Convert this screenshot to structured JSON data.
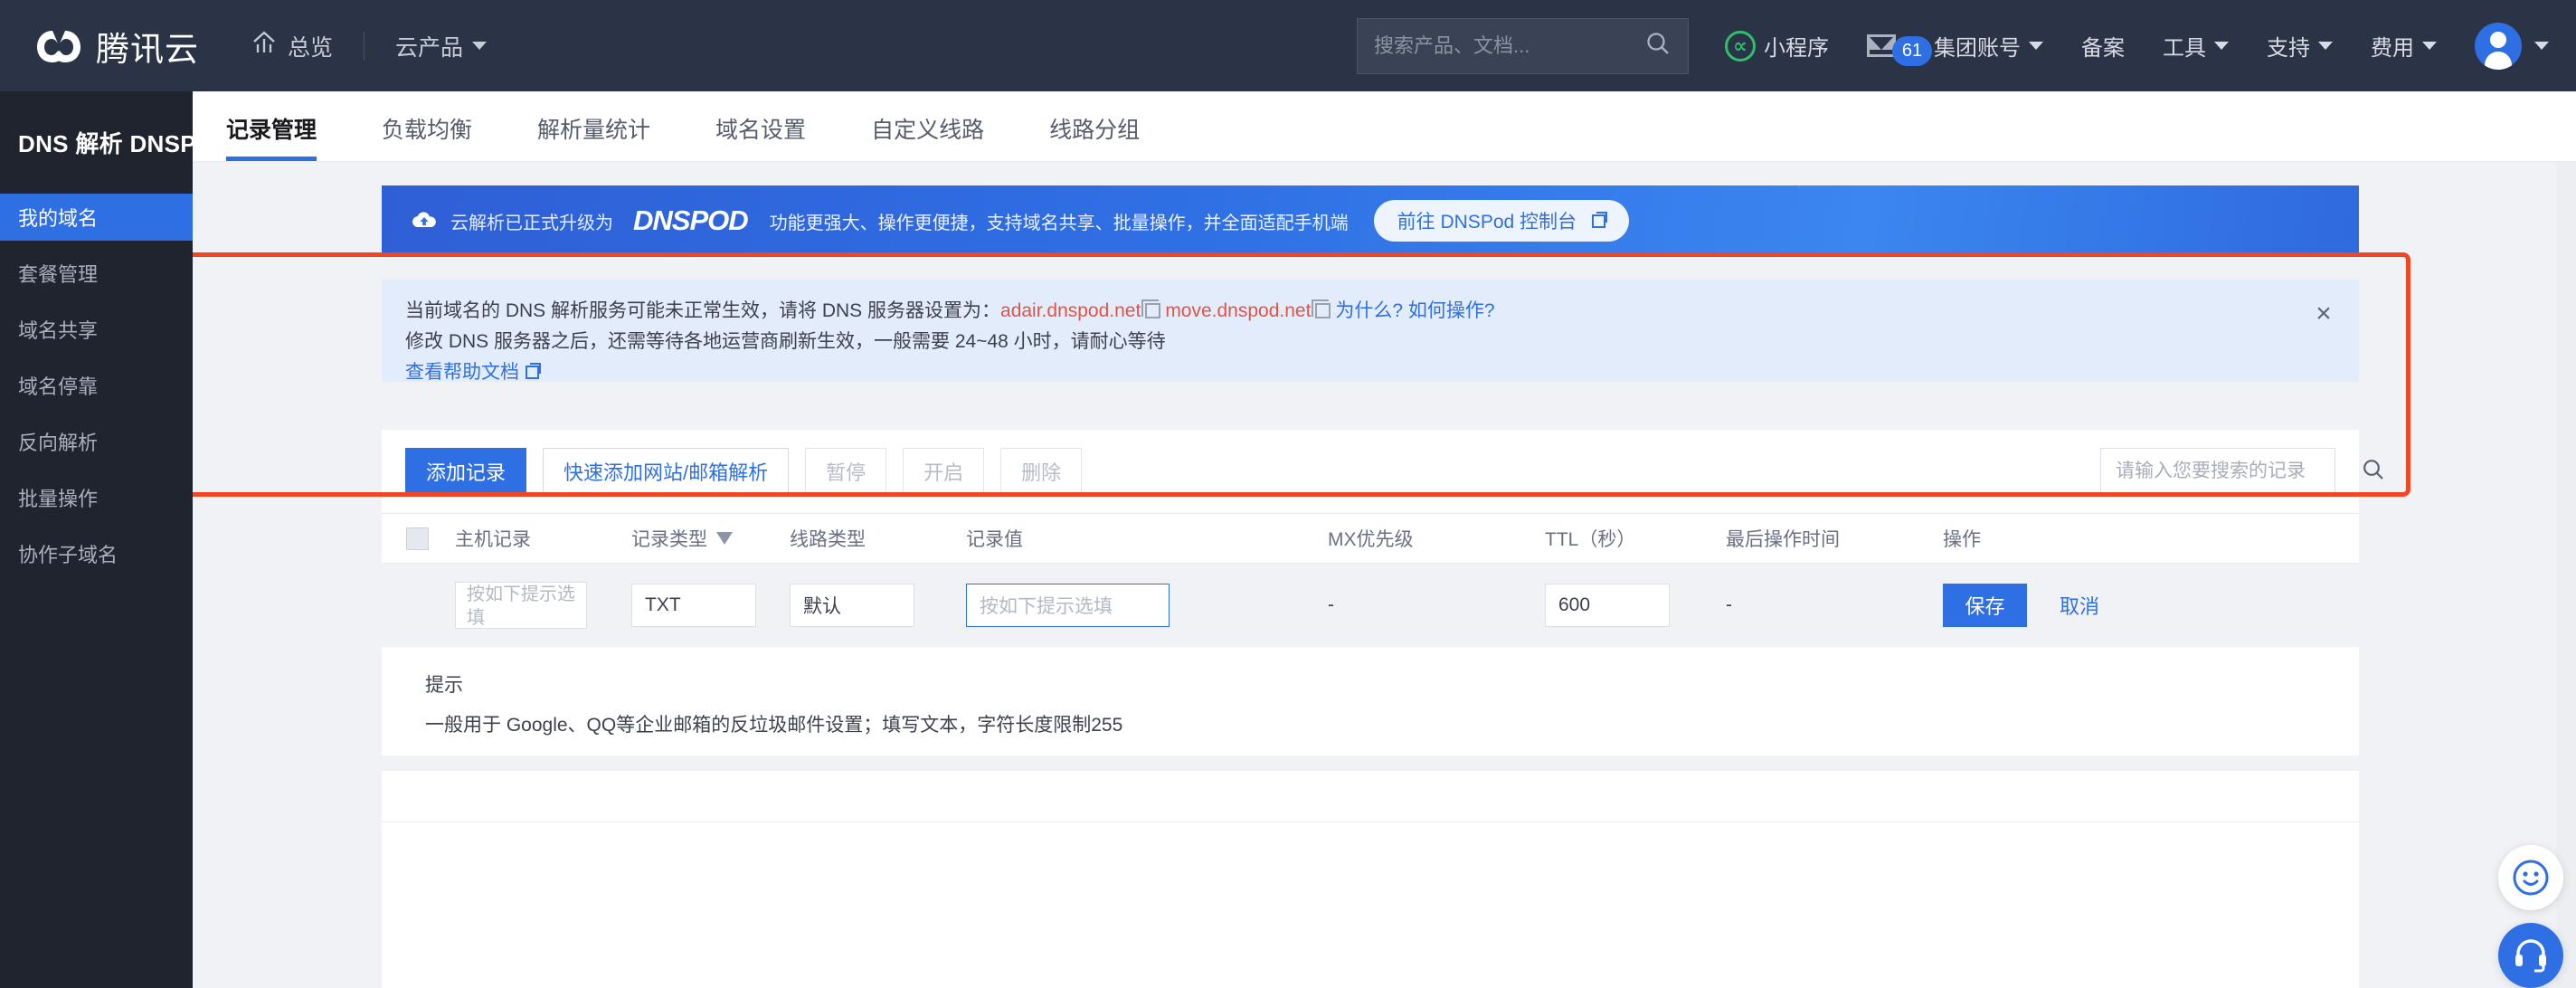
{
  "header": {
    "logo_text": "腾讯云",
    "logo_icon": "tencent-cloud-logo",
    "overview_label": "总览",
    "overview_icon": "home-icon",
    "products_label": "云产品",
    "search_placeholder": "搜索产品、文档...",
    "search_value": "",
    "search_icon": "search-icon",
    "miniprogram_label": "小程序",
    "miniprogram_icon": "miniprogram-icon",
    "mail_icon": "mail-icon",
    "mail_badge": "61",
    "group_account_label": "集团账号",
    "beian_label": "备案",
    "tools_label": "工具",
    "support_label": "支持",
    "billing_label": "费用",
    "avatar_icon": "avatar"
  },
  "sidebar": {
    "title": "DNS 解析 DNSPod",
    "items": [
      {
        "label": "我的域名",
        "active": true
      },
      {
        "label": "套餐管理",
        "active": false
      },
      {
        "label": "域名共享",
        "active": false
      },
      {
        "label": "域名停靠",
        "active": false
      },
      {
        "label": "反向解析",
        "active": false
      },
      {
        "label": "批量操作",
        "active": false
      },
      {
        "label": "协作子域名",
        "active": false
      }
    ]
  },
  "tabs": [
    {
      "label": "记录管理",
      "active": true
    },
    {
      "label": "负载均衡",
      "active": false
    },
    {
      "label": "解析量统计",
      "active": false
    },
    {
      "label": "域名设置",
      "active": false
    },
    {
      "label": "自定义线路",
      "active": false
    },
    {
      "label": "线路分组",
      "active": false
    }
  ],
  "banner": {
    "cloud_icon": "cloud-upgrade-icon",
    "text_before": "云解析已正式升级为",
    "brand": "DNSPOD",
    "text_after": "功能更强大、操作更便捷，支持域名共享、批量操作，并全面适配手机端",
    "button_label": "前往 DNSPod 控制台",
    "button_icon": "external-link-icon"
  },
  "alert": {
    "line1_prefix": "当前域名的 DNS 解析服务可能未正常生效，请将 DNS 服务器设置为：",
    "ns1": "adair.dnspod.net",
    "ns2": "move.dnspod.net",
    "copy_icon": "copy-icon",
    "line1_link": "为什么? 如何操作?",
    "line2": "修改 DNS 服务器之后，还需等待各地运营商刷新生效，一般需要 24~48 小时，请耐心等待",
    "line3_link": "查看帮助文档",
    "line3_icon": "external-link-icon",
    "close_icon": "close-icon"
  },
  "toolbar": {
    "add_record_label": "添加记录",
    "quick_add_label": "快速添加网站/邮箱解析",
    "pause_label": "暂停",
    "enable_label": "开启",
    "delete_label": "删除",
    "search_placeholder": "请输入您要搜索的记录",
    "search_value": "",
    "search_icon": "search-icon"
  },
  "table": {
    "select_all_icon": "checkbox-unchecked",
    "columns": [
      {
        "label": "主机记录",
        "filter": false
      },
      {
        "label": "记录类型",
        "filter": true
      },
      {
        "label": "线路类型",
        "filter": false
      },
      {
        "label": "记录值",
        "filter": false
      },
      {
        "label": "MX优先级",
        "filter": false
      },
      {
        "label": "TTL（秒）",
        "filter": false
      },
      {
        "label": "最后操作时间",
        "filter": false
      },
      {
        "label": "操作",
        "filter": false
      }
    ],
    "edit_row": {
      "host_placeholder": "按如下提示选填",
      "host_value": "",
      "record_type": "TXT",
      "line_type": "默认",
      "value_placeholder": "按如下提示选填",
      "value_value": "",
      "mx": "-",
      "ttl": "600",
      "last_time": "-",
      "save_label": "保存",
      "cancel_label": "取消"
    }
  },
  "tip": {
    "title": "提示",
    "body": "一般用于 Google、QQ等企业邮箱的反垃圾邮件设置；填写文本，字符长度限制255"
  },
  "float_buttons": [
    {
      "icon": "smiley-feedback-icon"
    },
    {
      "icon": "headset-support-icon"
    }
  ],
  "colors": {
    "accent": "#2f6fe4",
    "header_bg": "#2b3346",
    "sidebar_bg": "#20242e",
    "annotation": "#f04623",
    "alert_bg": "#e3ecfb",
    "danger_text": "#e05448"
  }
}
